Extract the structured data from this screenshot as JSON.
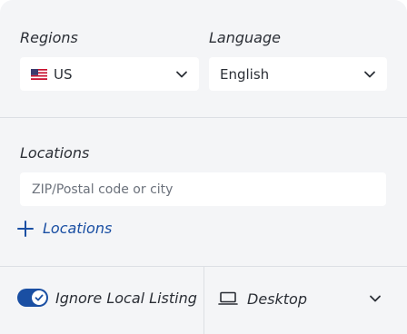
{
  "regions": {
    "label": "Regions",
    "selected": "US",
    "flag_icon": "us-flag-icon"
  },
  "language": {
    "label": "Language",
    "selected": "English"
  },
  "locations": {
    "label": "Locations",
    "placeholder": "ZIP/Postal code or city",
    "add_label": "Locations"
  },
  "local_listing": {
    "label": "Ignore Local Listing",
    "enabled": true
  },
  "device": {
    "selected": "Desktop",
    "icon": "laptop-icon"
  },
  "colors": {
    "accent": "#1a4fa3",
    "panel_bg": "#f4f5f7",
    "divider": "#dcdfe4"
  }
}
